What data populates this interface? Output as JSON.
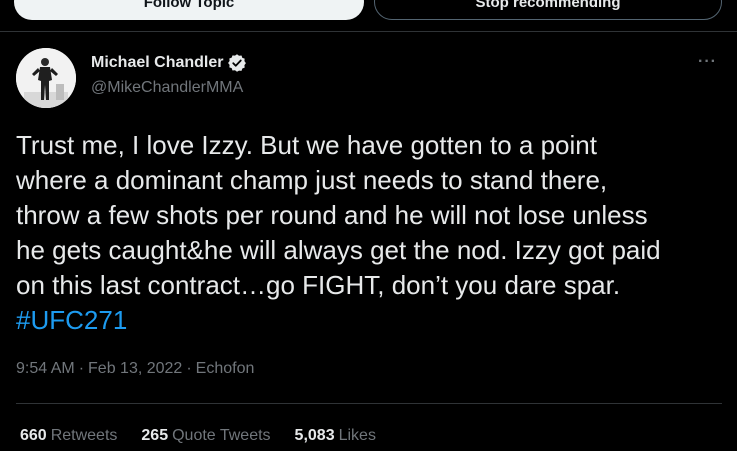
{
  "buttons": {
    "follow_topic": "Follow Topic",
    "stop_recommending": "Stop recommending"
  },
  "author": {
    "name": "Michael Chandler",
    "handle": "@MikeChandlerMMA",
    "verified_icon": "verified-badge-icon"
  },
  "more_label": "···",
  "tweet": {
    "text": "Trust me, I love Izzy. But we have gotten to a point\nwhere a dominant champ just needs to stand there,\nthrow a few shots per round and he will not lose unless\nhe gets caught&he will always get the nod. Izzy got paid\non this last contract…go FIGHT, don’t you dare spar.",
    "hashtag": "#UFC271"
  },
  "meta": {
    "time": "9:54 AM",
    "sep1": "·",
    "date": "Feb 13, 2022",
    "sep2": "·",
    "source": "Echofon"
  },
  "stats": [
    {
      "count": "660",
      "label": "Retweets"
    },
    {
      "count": "265",
      "label": "Quote Tweets"
    },
    {
      "count": "5,083",
      "label": "Likes"
    }
  ],
  "colors": {
    "background": "#000000",
    "text": "#e7e9ea",
    "muted": "#71767b",
    "link": "#1d9bf0",
    "border": "#2f3336"
  }
}
